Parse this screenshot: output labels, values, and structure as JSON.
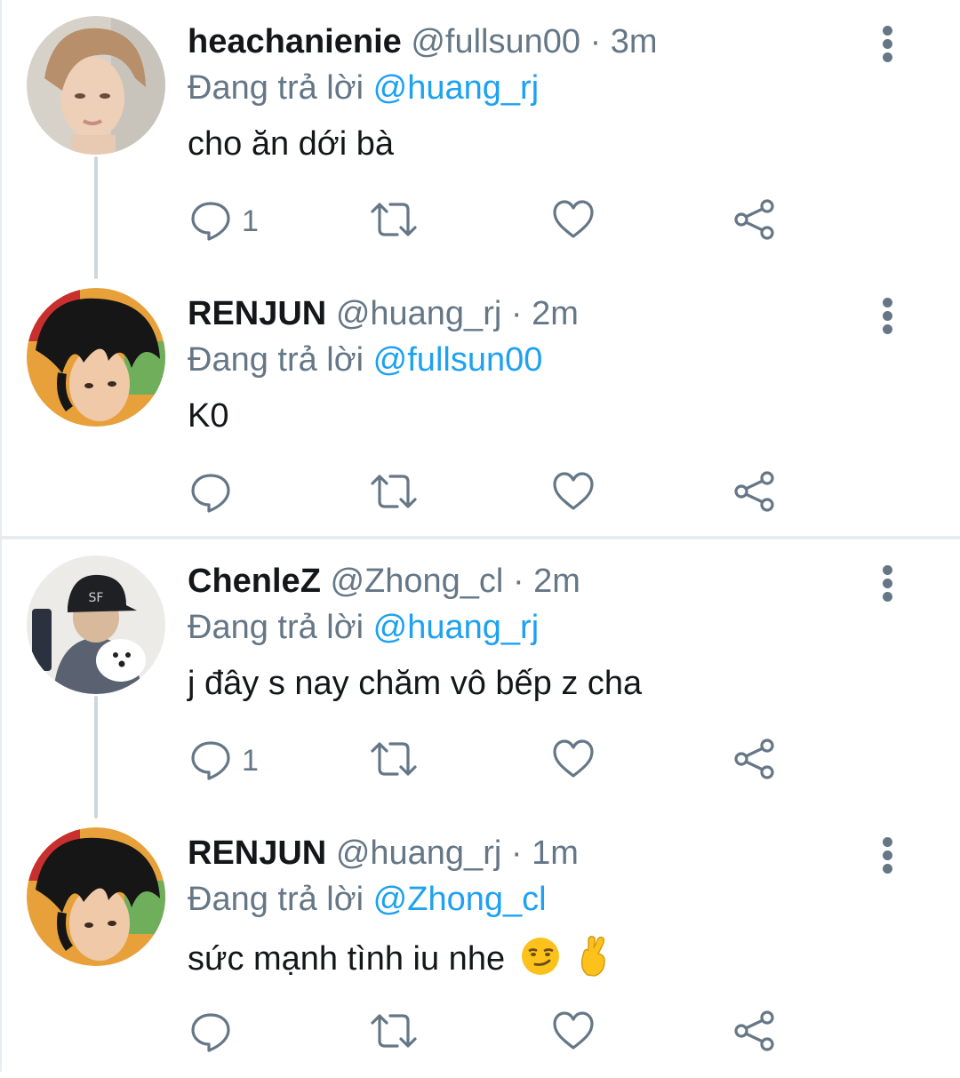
{
  "threads": [
    {
      "tweets": [
        {
          "name": "heachanienie",
          "handle": "@fullsun00",
          "separator": "·",
          "time": "3m",
          "reply_prefix": "Đang trả lời",
          "reply_to": "@huang_rj",
          "text": "cho ăn dới bà",
          "reply_count": "1",
          "avatar": "avatar-soft-portrait"
        },
        {
          "name": "RENJUN",
          "handle": "@huang_rj",
          "separator": "·",
          "time": "2m",
          "reply_prefix": "Đang trả lời",
          "reply_to": "@fullsun00",
          "text": "K0",
          "reply_count": "",
          "avatar": "avatar-dark-hair-portrait"
        }
      ]
    },
    {
      "tweets": [
        {
          "name": "ChenleZ",
          "handle": "@Zhong_cl",
          "separator": "·",
          "time": "2m",
          "reply_prefix": "Đang trả lời",
          "reply_to": "@huang_rj",
          "text": "j đây s nay chăm vô bếp z cha",
          "reply_count": "1",
          "avatar": "avatar-cap-with-dog"
        },
        {
          "name": "RENJUN",
          "handle": "@huang_rj",
          "separator": "·",
          "time": "1m",
          "reply_prefix": "Đang trả lời",
          "reply_to": "@Zhong_cl",
          "text": "sức mạnh tình iu nhe",
          "emojis": [
            "smirking-face-emoji",
            "crossed-fingers-emoji"
          ],
          "reply_count": "",
          "avatar": "avatar-dark-hair-portrait"
        }
      ]
    }
  ],
  "colors": {
    "text_primary": "#14171a",
    "text_secondary": "#657786",
    "link": "#1da1f2",
    "divider": "#e6ecf0",
    "thread_line": "#ccd6dd"
  }
}
